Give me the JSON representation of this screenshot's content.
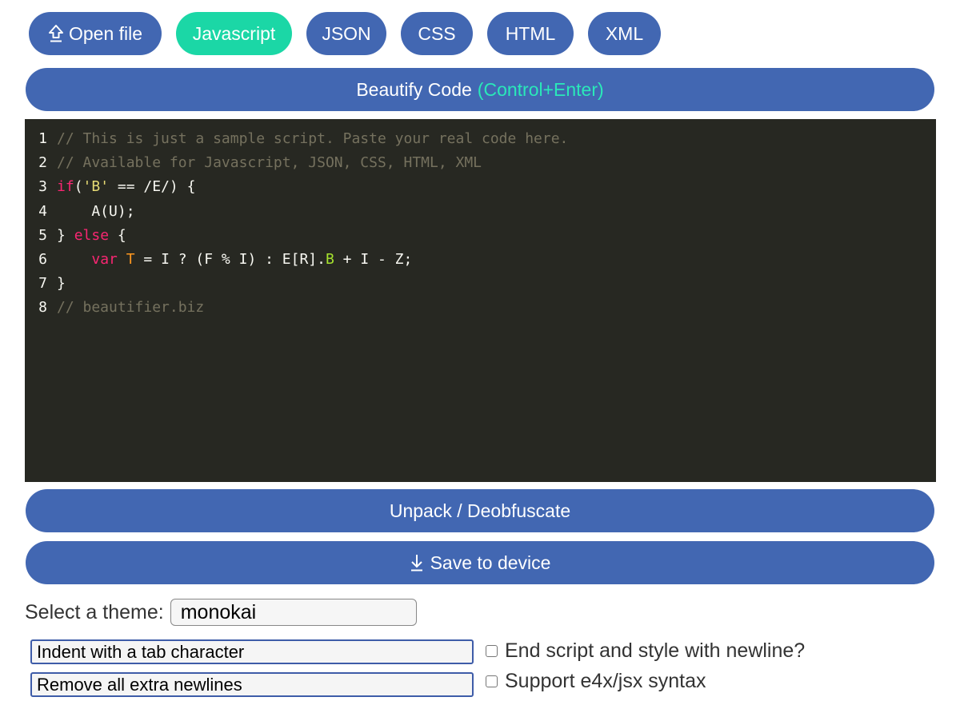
{
  "toolbar": {
    "open_file_icon": "upload-arrow",
    "open_file_label": "Open file",
    "languages": [
      "Javascript",
      "JSON",
      "CSS",
      "HTML",
      "XML"
    ],
    "active_language": "Javascript"
  },
  "beautify": {
    "label": "Beautify Code",
    "shortcut": "(Control+Enter)"
  },
  "editor": {
    "line_numbers": [
      "1",
      "2",
      "3",
      "4",
      "5",
      "6",
      "7",
      "8"
    ],
    "lines": [
      "// This is just a sample script. Paste your real code here.",
      "// Available for Javascript, JSON, CSS, HTML, XML",
      "if('B' == /E/) {",
      "    A(U);",
      "} else {",
      "    var T = I ? (F % I) : E[R].B + I - Z;",
      "}",
      "// beautifier.biz"
    ]
  },
  "unpack": {
    "label": "Unpack / Deobfuscate"
  },
  "save": {
    "icon": "download-arrow",
    "label": "Save to device"
  },
  "theme": {
    "label": "Select a theme:",
    "value": "monokai"
  },
  "options": {
    "indent_value": "Indent with a tab character",
    "newlines_value": "Remove all extra newlines",
    "end_script_label": "End script and style with newline?",
    "end_script_checked": false,
    "e4x_label": "Support e4x/jsx syntax",
    "e4x_checked": false
  },
  "colors": {
    "primary": "#4267b2",
    "active": "#1bd7a6",
    "accent_text": "#2ae9b9",
    "editor_bg": "#272822"
  }
}
